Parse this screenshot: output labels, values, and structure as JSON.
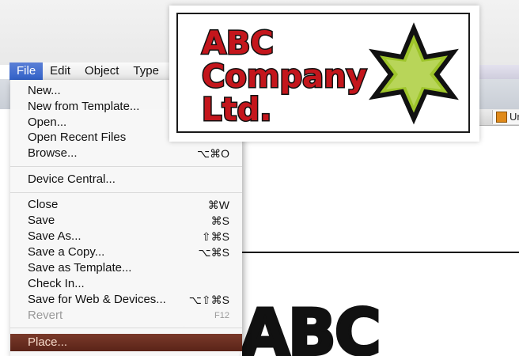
{
  "menubar": {
    "items": [
      "File",
      "Edit",
      "Object",
      "Type"
    ],
    "active_index": 0
  },
  "file_menu": {
    "new": {
      "label": "New..."
    },
    "new_from_template": {
      "label": "New from Template..."
    },
    "open": {
      "label": "Open..."
    },
    "open_recent": {
      "label": "Open Recent Files"
    },
    "browse": {
      "label": "Browse...",
      "shortcut": "⌥⌘O"
    },
    "device_central": {
      "label": "Device Central..."
    },
    "close": {
      "label": "Close",
      "shortcut": "⌘W"
    },
    "save": {
      "label": "Save",
      "shortcut": "⌘S"
    },
    "save_as": {
      "label": "Save As...",
      "shortcut": "⇧⌘S"
    },
    "save_copy": {
      "label": "Save a Copy...",
      "shortcut": "⌥⌘S"
    },
    "save_template": {
      "label": "Save as Template..."
    },
    "check_in": {
      "label": "Check In..."
    },
    "save_web": {
      "label": "Save for Web & Devices...",
      "shortcut": "⌥⇧⌘S"
    },
    "revert": {
      "label": "Revert",
      "shortcut": "F12"
    },
    "place": {
      "label": "Place..."
    }
  },
  "logo": {
    "line1": "ABC",
    "line2": "Company",
    "line3": "Ltd.",
    "text_color": "#c4161c",
    "outline_color": "#111111",
    "star_fill": "#9ec52a",
    "star_outline": "#111111"
  },
  "tab": {
    "label": "Ur"
  },
  "canvas_text": "ABC"
}
